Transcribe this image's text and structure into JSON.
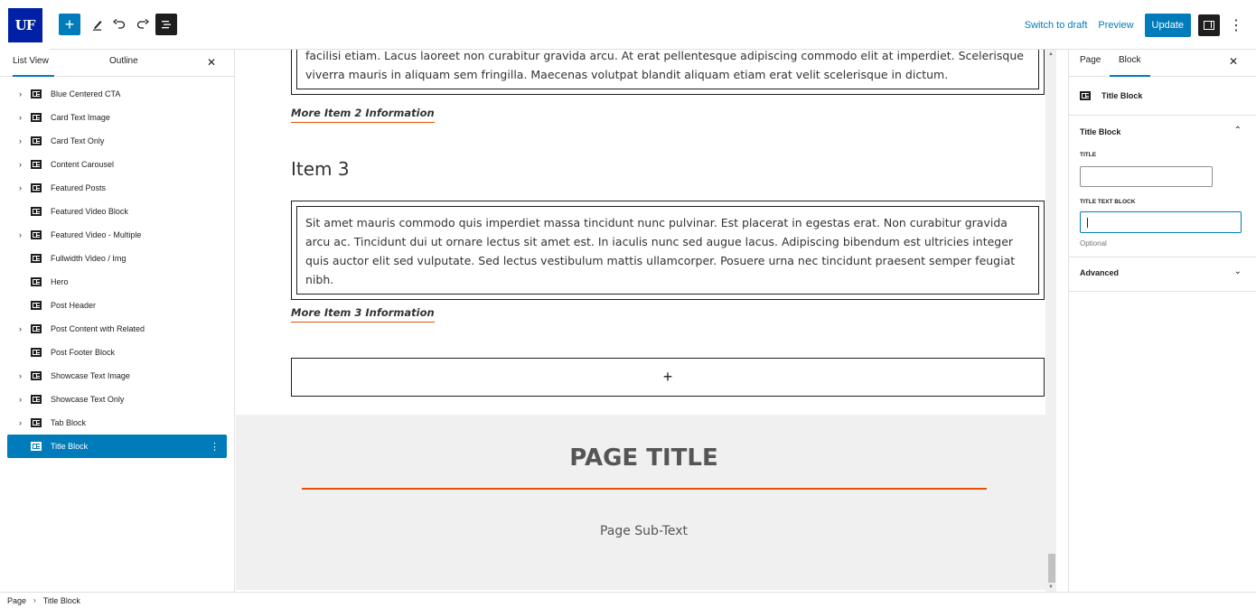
{
  "toolbar": {
    "logo_text": "UF",
    "add_icon": "plus-icon",
    "tools_icon": "pencil-icon",
    "undo_icon": "undo-icon",
    "redo_icon": "redo-icon",
    "list_view_icon": "list-view-icon",
    "switch_to_draft": "Switch to draft",
    "preview": "Preview",
    "update": "Update",
    "settings_icon": "sidebar-toggle-icon",
    "options_icon": "more-vertical-icon",
    "accent": "#007cba"
  },
  "list_view": {
    "tabs": [
      "List View",
      "Outline"
    ],
    "close_icon": "close-icon",
    "items": [
      {
        "label": "Blue Centered CTA",
        "expandable": true
      },
      {
        "label": "Card Text Image",
        "expandable": true
      },
      {
        "label": "Card Text Only",
        "expandable": true
      },
      {
        "label": "Content Carousel",
        "expandable": true
      },
      {
        "label": "Featured Posts",
        "expandable": true
      },
      {
        "label": "Featured Video Block",
        "expandable": false
      },
      {
        "label": "Featured Video - Multiple",
        "expandable": true
      },
      {
        "label": "Fullwidth Video / Img",
        "expandable": false
      },
      {
        "label": "Hero",
        "expandable": false
      },
      {
        "label": "Post Header",
        "expandable": false
      },
      {
        "label": "Post Content with Related",
        "expandable": true
      },
      {
        "label": "Post Footer Block",
        "expandable": false
      },
      {
        "label": "Showcase Text Image",
        "expandable": true
      },
      {
        "label": "Showcase Text Only",
        "expandable": true
      },
      {
        "label": "Tab Block",
        "expandable": true
      },
      {
        "label": "Title Block",
        "expandable": false,
        "selected": true
      }
    ]
  },
  "canvas": {
    "item2_text_line1": "facilisi etiam. Lacus laoreet non curabitur gravida arcu. At erat pellentesque adipiscing commodo elit at imperdiet. Scelerisque",
    "item2_text_line2": "viverra mauris in aliquam sem fringilla. Maecenas volutpat blandit aliquam etiam erat velit scelerisque in dictum.",
    "item2_more": "More Item 2 Information",
    "item3_heading": "Item 3",
    "item3_text": "Sit amet mauris commodo quis imperdiet massa tincidunt nunc pulvinar. Est placerat in egestas erat. Non curabitur gravida arcu ac. Tincidunt dui ut ornare lectus sit amet est. In iaculis nunc sed augue lacus. Adipiscing bibendum est ultricies integer quis auctor elit sed vulputate. Sed lectus vestibulum mattis ullamcorper. Posuere urna nec tincidunt praesent semper feugiat nibh.",
    "item3_more": "More Item 3 Information",
    "appender": "+",
    "page_title": "PAGE TITLE",
    "page_subtext": "Page Sub-Text",
    "accent_line": "#e35205",
    "scroll_fraction": 0.93
  },
  "sidebar": {
    "tabs": [
      "Page",
      "Block"
    ],
    "active_tab": "Block",
    "close_icon": "close-icon",
    "block_name": "Title Block",
    "section_title": "Title Block",
    "title_label": "TITLE",
    "title_value": "",
    "text_block_label": "TITLE TEXT BLOCK",
    "text_block_value": "",
    "optional": "Optional",
    "advanced": "Advanced"
  },
  "breadcrumb": {
    "items": [
      "Page",
      "Title Block"
    ]
  }
}
